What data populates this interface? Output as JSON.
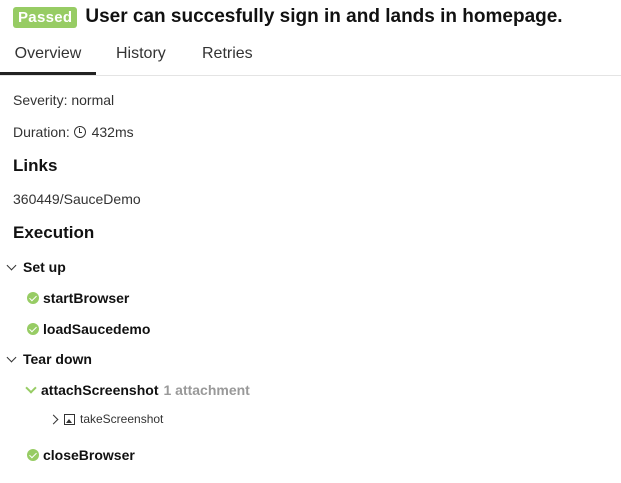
{
  "header": {
    "status_badge": "Passed",
    "title": "User can succesfully sign in and lands in homepage."
  },
  "tabs": [
    {
      "label": "Overview",
      "active": true
    },
    {
      "label": "History",
      "active": false
    },
    {
      "label": "Retries",
      "active": false
    }
  ],
  "overview": {
    "severity": "Severity: normal",
    "duration_label": "Duration:",
    "duration_value": "432ms"
  },
  "links": {
    "heading": "Links",
    "items": [
      "360449/SauceDemo"
    ]
  },
  "execution": {
    "heading": "Execution",
    "setup_label": "Set up",
    "setup_steps": [
      "startBrowser",
      "loadSaucedemo"
    ],
    "teardown_label": "Tear down",
    "attach_step": "attachScreenshot",
    "attach_count": "1 attachment",
    "attachment_name": "takeScreenshot",
    "close_step": "closeBrowser"
  },
  "colors": {
    "passed": "#97cc64"
  }
}
